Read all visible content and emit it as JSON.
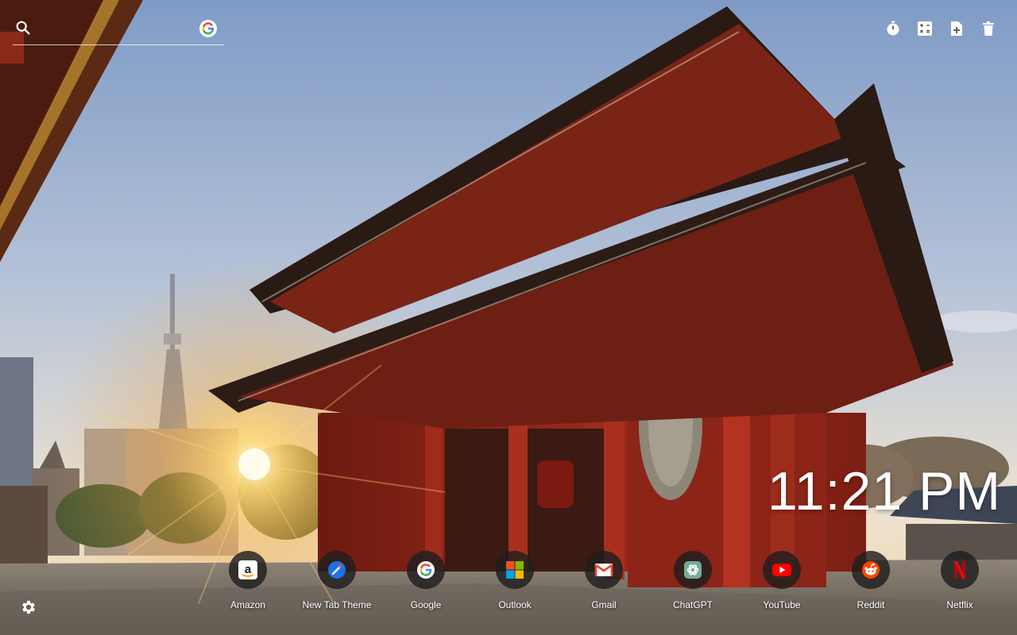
{
  "search": {
    "placeholder": ""
  },
  "toolbar": [
    {
      "icon": "timer-icon"
    },
    {
      "icon": "calculator-icon"
    },
    {
      "icon": "add-note-icon"
    },
    {
      "icon": "trash-icon"
    }
  ],
  "clock": {
    "time": "11:21 PM"
  },
  "shortcuts": [
    {
      "label": "Amazon",
      "icon": "amazon-icon"
    },
    {
      "label": "New Tab Theme",
      "icon": "new-tab-theme-icon"
    },
    {
      "label": "Google",
      "icon": "google-icon"
    },
    {
      "label": "Outlook",
      "icon": "outlook-icon"
    },
    {
      "label": "Gmail",
      "icon": "gmail-icon"
    },
    {
      "label": "ChatGPT",
      "icon": "chatgpt-icon"
    },
    {
      "label": "YouTube",
      "icon": "youtube-icon"
    },
    {
      "label": "Reddit",
      "icon": "reddit-icon"
    },
    {
      "label": "Netflix",
      "icon": "netflix-icon"
    }
  ],
  "colors": {
    "sky_top": "#7e9ac4",
    "sky_bottom": "#e9e1d6",
    "temple_red": "#8b1e14",
    "roof_dark": "#2a1a14"
  }
}
